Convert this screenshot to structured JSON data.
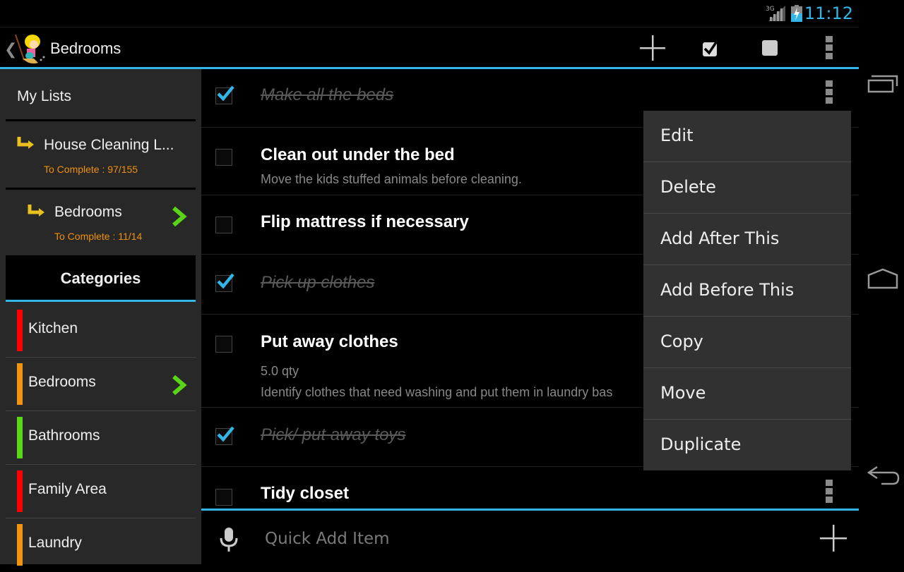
{
  "status_bar": {
    "network": "3G",
    "time": "11:12",
    "accent_color": "#33b5e5"
  },
  "action_bar": {
    "title": "Bedrooms",
    "icons": [
      "up-caret-icon",
      "app-logo-icon",
      "add-icon",
      "check-all-icon",
      "uncheck-all-icon",
      "overflow-menu-icon"
    ]
  },
  "sidebar": {
    "my_lists_label": "My Lists",
    "lists": [
      {
        "title": "House Cleaning L...",
        "subtitle": "To Complete : 97/155",
        "selected": false
      },
      {
        "title": "Bedrooms",
        "subtitle": "To Complete : 11/14",
        "selected": true
      }
    ],
    "categories_label": "Categories",
    "categories": [
      {
        "name": "Kitchen",
        "color": "#ff0000",
        "selected": false
      },
      {
        "name": "Bedrooms",
        "color": "#f39410",
        "selected": true
      },
      {
        "name": "Bathrooms",
        "color": "#58d814",
        "selected": false
      },
      {
        "name": "Family Area",
        "color": "#ff0000",
        "selected": false
      },
      {
        "name": "Laundry",
        "color": "#f39410",
        "selected": false
      }
    ]
  },
  "items": [
    {
      "title": "Make all the beds",
      "checked": true,
      "details": []
    },
    {
      "title": "Clean out under the bed",
      "checked": false,
      "details": [
        "Move the kids stuffed animals before cleaning."
      ]
    },
    {
      "title": "Flip mattress if necessary",
      "checked": false,
      "details": []
    },
    {
      "title": "Pick up clothes",
      "checked": true,
      "details": []
    },
    {
      "title": "Put away clothes",
      "checked": false,
      "details": [
        "5.0 qty",
        "Identify clothes that need washing and put them in laundry bas"
      ]
    },
    {
      "title": "Pick/ put away toys",
      "checked": true,
      "details": []
    },
    {
      "title": "Tidy closet",
      "checked": false,
      "details": []
    }
  ],
  "context_menu": {
    "items": [
      "Edit",
      "Delete",
      "Add After This",
      "Add Before This",
      "Copy",
      "Move",
      "Duplicate"
    ]
  },
  "quick_add": {
    "placeholder": "Quick Add Item",
    "value": ""
  },
  "nav_bar": {
    "icons": [
      "recent-apps-icon",
      "home-icon",
      "back-icon"
    ]
  }
}
